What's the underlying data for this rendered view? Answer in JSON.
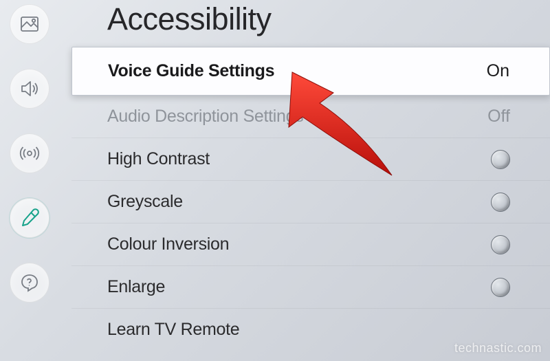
{
  "page": {
    "title": "Accessibility"
  },
  "sidebar": {
    "items": [
      {
        "name": "picture-icon"
      },
      {
        "name": "sound-icon"
      },
      {
        "name": "broadcast-icon"
      },
      {
        "name": "general-icon",
        "selected": true
      },
      {
        "name": "support-icon"
      }
    ]
  },
  "rows": [
    {
      "label": "Voice Guide Settings",
      "value": "On",
      "type": "text",
      "selected": true,
      "disabled": false
    },
    {
      "label": "Audio Description Settings",
      "value": "Off",
      "type": "text",
      "selected": false,
      "disabled": true
    },
    {
      "label": "High Contrast",
      "value": "",
      "type": "radio",
      "selected": false,
      "disabled": false
    },
    {
      "label": "Greyscale",
      "value": "",
      "type": "radio",
      "selected": false,
      "disabled": false
    },
    {
      "label": "Colour Inversion",
      "value": "",
      "type": "radio",
      "selected": false,
      "disabled": false
    },
    {
      "label": "Enlarge",
      "value": "",
      "type": "radio",
      "selected": false,
      "disabled": false
    },
    {
      "label": "Learn TV Remote",
      "value": "",
      "type": "link",
      "selected": false,
      "disabled": false
    }
  ],
  "watermark": "technastic.com",
  "colors": {
    "accent": "#17a28a",
    "annotation": "#e0261e"
  }
}
